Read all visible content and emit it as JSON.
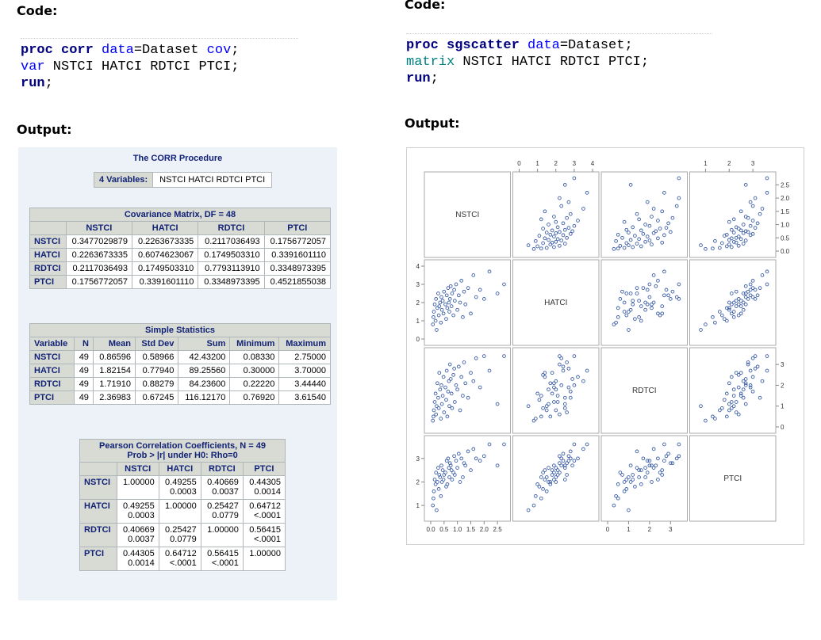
{
  "left": {
    "code_heading": "Code:",
    "code_lines": [
      [
        {
          "t": "proc corr",
          "c": "kw"
        },
        {
          "t": " data",
          "c": "blue"
        },
        {
          "t": "=Dataset ",
          "c": "plain"
        },
        {
          "t": "cov",
          "c": "blue"
        },
        {
          "t": ";",
          "c": "plain"
        }
      ],
      [
        {
          "t": "var",
          "c": "blue"
        },
        {
          "t": " NSTCI HATCI RDTCI PTCI;",
          "c": "plain"
        }
      ],
      [
        {
          "t": "run",
          "c": "kw"
        },
        {
          "t": ";",
          "c": "plain"
        }
      ]
    ],
    "output_heading": "Output:",
    "proc_title": "The CORR Procedure",
    "vars_label": "4 Variables:",
    "vars_value": "NSTCI HATCI RDTCI PTCI",
    "cov": {
      "title": "Covariance Matrix, DF = 48",
      "cols": [
        "NSTCI",
        "HATCI",
        "RDTCI",
        "PTCI"
      ],
      "rows": [
        {
          "name": "NSTCI",
          "vals": [
            "0.3477029879",
            "0.2263673335",
            "0.2117036493",
            "0.1756772057"
          ]
        },
        {
          "name": "HATCI",
          "vals": [
            "0.2263673335",
            "0.6074623067",
            "0.1749503310",
            "0.3391601110"
          ]
        },
        {
          "name": "RDTCI",
          "vals": [
            "0.2117036493",
            "0.1749503310",
            "0.7793113910",
            "0.3348973395"
          ]
        },
        {
          "name": "PTCI",
          "vals": [
            "0.1756772057",
            "0.3391601110",
            "0.3348973395",
            "0.4521855038"
          ]
        }
      ]
    },
    "stats": {
      "title": "Simple Statistics",
      "cols": [
        "Variable",
        "N",
        "Mean",
        "Std Dev",
        "Sum",
        "Minimum",
        "Maximum"
      ],
      "rows": [
        {
          "name": "NSTCI",
          "vals": [
            "49",
            "0.86596",
            "0.58966",
            "42.43200",
            "0.08330",
            "2.75000"
          ]
        },
        {
          "name": "HATCI",
          "vals": [
            "49",
            "1.82154",
            "0.77940",
            "89.25560",
            "0.30000",
            "3.70000"
          ]
        },
        {
          "name": "RDTCI",
          "vals": [
            "49",
            "1.71910",
            "0.88279",
            "84.23600",
            "0.22220",
            "3.44440"
          ]
        },
        {
          "name": "PTCI",
          "vals": [
            "49",
            "2.36983",
            "0.67245",
            "116.12170",
            "0.76920",
            "3.61540"
          ]
        }
      ]
    },
    "pearson": {
      "title1": "Pearson Correlation Coefficients, N = 49",
      "title2": "Prob > |r| under H0: Rho=0",
      "cols": [
        "NSTCI",
        "HATCI",
        "RDTCI",
        "PTCI"
      ],
      "rows": [
        {
          "name": "NSTCI",
          "vals": [
            [
              "1.00000",
              ""
            ],
            [
              "0.49255",
              "0.0003"
            ],
            [
              "0.40669",
              "0.0037"
            ],
            [
              "0.44305",
              "0.0014"
            ]
          ]
        },
        {
          "name": "HATCI",
          "vals": [
            [
              "0.49255",
              "0.0003"
            ],
            [
              "1.00000",
              ""
            ],
            [
              "0.25427",
              "0.0779"
            ],
            [
              "0.64712",
              "<.0001"
            ]
          ]
        },
        {
          "name": "RDTCI",
          "vals": [
            [
              "0.40669",
              "0.0037"
            ],
            [
              "0.25427",
              "0.0779"
            ],
            [
              "1.00000",
              ""
            ],
            [
              "0.56415",
              "<.0001"
            ]
          ]
        },
        {
          "name": "PTCI",
          "vals": [
            [
              "0.44305",
              "0.0014"
            ],
            [
              "0.64712",
              "<.0001"
            ],
            [
              "0.56415",
              "<.0001"
            ],
            [
              "1.00000",
              ""
            ]
          ]
        }
      ]
    }
  },
  "right": {
    "code_heading": "Code:",
    "code_lines": [
      [
        {
          "t": "proc sgscatter",
          "c": "kw"
        },
        {
          "t": " data",
          "c": "blue"
        },
        {
          "t": "=Dataset;",
          "c": "plain"
        }
      ],
      [
        {
          "t": "matrix",
          "c": "teal"
        },
        {
          "t": " NSTCI HATCI RDTCI PTCI;",
          "c": "plain"
        }
      ],
      [
        {
          "t": "run",
          "c": "kw"
        },
        {
          "t": ";",
          "c": "plain"
        }
      ]
    ],
    "output_heading": "Output:"
  },
  "chart_data": {
    "type": "scatter",
    "variables": [
      "NSTCI",
      "HATCI",
      "RDTCI",
      "PTCI"
    ],
    "ranges": {
      "NSTCI": [
        0,
        2.75
      ],
      "HATCI": [
        0,
        4
      ],
      "RDTCI": [
        0,
        3.5
      ],
      "PTCI": [
        0.6,
        3.7
      ]
    },
    "ticks": {
      "NSTCI": [
        "0.0",
        "0.5",
        "1.0",
        "1.5",
        "2.0",
        "2.5"
      ],
      "HATCI": [
        "0",
        "1",
        "2",
        "3",
        "4"
      ],
      "RDTCI": [
        "0",
        "1",
        "2",
        "3"
      ],
      "PTCI": [
        "1",
        "2",
        "3"
      ]
    },
    "observations": [
      {
        "NSTCI": 0.08,
        "HATCI": 0.8,
        "RDTCI": 0.3,
        "PTCI": 1.0
      },
      {
        "NSTCI": 0.1,
        "HATCI": 1.2,
        "RDTCI": 0.5,
        "PTCI": 1.3
      },
      {
        "NSTCI": 0.12,
        "HATCI": 1.5,
        "RDTCI": 0.8,
        "PTCI": 1.6
      },
      {
        "NSTCI": 0.15,
        "HATCI": 1.9,
        "RDTCI": 1.2,
        "PTCI": 2.1
      },
      {
        "NSTCI": 0.18,
        "HATCI": 1.0,
        "RDTCI": 1.6,
        "PTCI": 1.9
      },
      {
        "NSTCI": 0.2,
        "HATCI": 2.2,
        "RDTCI": 0.6,
        "PTCI": 2.4
      },
      {
        "NSTCI": 0.22,
        "HATCI": 0.5,
        "RDTCI": 1.0,
        "PTCI": 0.8
      },
      {
        "NSTCI": 0.25,
        "HATCI": 1.7,
        "RDTCI": 2.1,
        "PTCI": 2.0
      },
      {
        "NSTCI": 0.28,
        "HATCI": 2.5,
        "RDTCI": 1.4,
        "PTCI": 2.6
      },
      {
        "NSTCI": 0.3,
        "HATCI": 1.3,
        "RDTCI": 0.9,
        "PTCI": 1.7
      },
      {
        "NSTCI": 0.32,
        "HATCI": 1.8,
        "RDTCI": 2.6,
        "PTCI": 2.3
      },
      {
        "NSTCI": 0.35,
        "HATCI": 2.0,
        "RDTCI": 1.8,
        "PTCI": 2.2
      },
      {
        "NSTCI": 0.38,
        "HATCI": 0.9,
        "RDTCI": 0.4,
        "PTCI": 1.4
      },
      {
        "NSTCI": 0.4,
        "HATCI": 2.3,
        "RDTCI": 2.0,
        "PTCI": 2.7
      },
      {
        "NSTCI": 0.42,
        "HATCI": 1.6,
        "RDTCI": 1.1,
        "PTCI": 2.0
      },
      {
        "NSTCI": 0.45,
        "HATCI": 2.1,
        "RDTCI": 1.5,
        "PTCI": 2.5
      },
      {
        "NSTCI": 0.48,
        "HATCI": 1.4,
        "RDTCI": 2.4,
        "PTCI": 2.1
      },
      {
        "NSTCI": 0.5,
        "HATCI": 2.6,
        "RDTCI": 0.7,
        "PTCI": 2.3
      },
      {
        "NSTCI": 0.55,
        "HATCI": 1.9,
        "RDTCI": 1.9,
        "PTCI": 2.4
      },
      {
        "NSTCI": 0.58,
        "HATCI": 1.1,
        "RDTCI": 1.3,
        "PTCI": 1.8
      },
      {
        "NSTCI": 0.6,
        "HATCI": 2.4,
        "RDTCI": 2.7,
        "PTCI": 2.9
      },
      {
        "NSTCI": 0.62,
        "HATCI": 1.7,
        "RDTCI": 0.5,
        "PTCI": 1.9
      },
      {
        "NSTCI": 0.65,
        "HATCI": 2.8,
        "RDTCI": 1.7,
        "PTCI": 3.0
      },
      {
        "NSTCI": 0.68,
        "HATCI": 2.0,
        "RDTCI": 2.2,
        "PTCI": 2.6
      },
      {
        "NSTCI": 0.7,
        "HATCI": 1.5,
        "RDTCI": 1.0,
        "PTCI": 2.2
      },
      {
        "NSTCI": 0.72,
        "HATCI": 2.2,
        "RDTCI": 3.0,
        "PTCI": 2.8
      },
      {
        "NSTCI": 0.75,
        "HATCI": 2.9,
        "RDTCI": 2.3,
        "PTCI": 2.7
      },
      {
        "NSTCI": 0.78,
        "HATCI": 1.8,
        "RDTCI": 1.6,
        "PTCI": 2.5
      },
      {
        "NSTCI": 0.8,
        "HATCI": 2.5,
        "RDTCI": 0.9,
        "PTCI": 2.1
      },
      {
        "NSTCI": 0.85,
        "HATCI": 1.3,
        "RDTCI": 2.5,
        "PTCI": 2.4
      },
      {
        "NSTCI": 0.88,
        "HATCI": 2.7,
        "RDTCI": 2.8,
        "PTCI": 3.1
      },
      {
        "NSTCI": 0.9,
        "HATCI": 2.1,
        "RDTCI": 1.2,
        "PTCI": 2.3
      },
      {
        "NSTCI": 0.95,
        "HATCI": 3.0,
        "RDTCI": 2.0,
        "PTCI": 2.9
      },
      {
        "NSTCI": 1.0,
        "HATCI": 1.6,
        "RDTCI": 1.8,
        "PTCI": 2.6
      },
      {
        "NSTCI": 1.05,
        "HATCI": 2.4,
        "RDTCI": 2.9,
        "PTCI": 3.2
      },
      {
        "NSTCI": 1.1,
        "HATCI": 2.0,
        "RDTCI": 0.8,
        "PTCI": 2.0
      },
      {
        "NSTCI": 1.15,
        "HATCI": 3.2,
        "RDTCI": 2.4,
        "PTCI": 3.0
      },
      {
        "NSTCI": 1.2,
        "HATCI": 1.2,
        "RDTCI": 1.5,
        "PTCI": 2.2
      },
      {
        "NSTCI": 1.25,
        "HATCI": 2.6,
        "RDTCI": 3.1,
        "PTCI": 2.8
      },
      {
        "NSTCI": 1.3,
        "HATCI": 1.9,
        "RDTCI": 2.1,
        "PTCI": 2.7
      },
      {
        "NSTCI": 1.4,
        "HATCI": 2.8,
        "RDTCI": 1.4,
        "PTCI": 3.3
      },
      {
        "NSTCI": 1.5,
        "HATCI": 1.4,
        "RDTCI": 2.6,
        "PTCI": 2.5
      },
      {
        "NSTCI": 1.6,
        "HATCI": 3.5,
        "RDTCI": 2.2,
        "PTCI": 3.4
      },
      {
        "NSTCI": 1.7,
        "HATCI": 2.3,
        "RDTCI": 3.3,
        "PTCI": 3.0
      },
      {
        "NSTCI": 1.85,
        "HATCI": 2.7,
        "RDTCI": 1.9,
        "PTCI": 2.9
      },
      {
        "NSTCI": 2.0,
        "HATCI": 2.2,
        "RDTCI": 3.4,
        "PTCI": 3.1
      },
      {
        "NSTCI": 2.2,
        "HATCI": 3.7,
        "RDTCI": 2.7,
        "PTCI": 3.6
      },
      {
        "NSTCI": 2.5,
        "HATCI": 2.5,
        "RDTCI": 1.1,
        "PTCI": 2.7
      },
      {
        "NSTCI": 2.75,
        "HATCI": 3.0,
        "RDTCI": 3.4,
        "PTCI": 3.6
      }
    ],
    "marker_color": "#3d5fa8"
  }
}
